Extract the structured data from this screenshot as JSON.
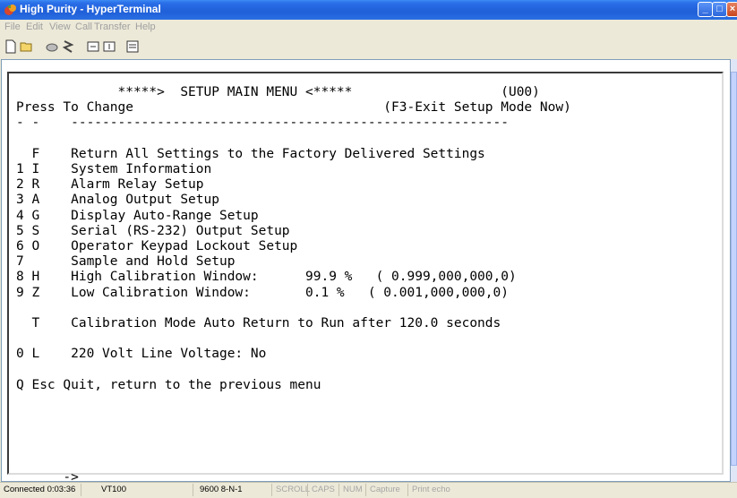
{
  "window": {
    "title": "High Purity - HyperTerminal"
  },
  "menu": [
    "File",
    "Edit",
    "View",
    "Call",
    "Transfer",
    "Help"
  ],
  "toolbar": {
    "icons": [
      "new-icon",
      "open-icon",
      "disconnect-icon",
      "properties-dial-icon",
      "send-icon",
      "receive-icon",
      "properties-icon"
    ]
  },
  "terminal": {
    "lines": [
      "             *****>  SETUP MAIN MENU <*****                   (U00)",
      "Press To Change                                (F3-Exit Setup Mode Now)",
      "- -    --------------------------------------------------------",
      "",
      "  F    Return All Settings to the Factory Delivered Settings",
      "1 I    System Information",
      "2 R    Alarm Relay Setup",
      "3 A    Analog Output Setup",
      "4 G    Display Auto-Range Setup",
      "5 S    Serial (RS-232) Output Setup",
      "6 O    Operator Keypad Lockout Setup",
      "7      Sample and Hold Setup",
      "8 H    High Calibration Window:      99.9 %   ( 0.999,000,000,0)",
      "9 Z    Low Calibration Window:       0.1 %   ( 0.001,000,000,0)",
      "",
      "  T    Calibration Mode Auto Return to Run after 120.0 seconds",
      "",
      "0 L    220 Volt Line Voltage: No",
      "",
      "Q Esc Quit, return to the previous menu",
      "",
      "",
      "",
      "",
      "",
      "      ->"
    ]
  },
  "status": {
    "connected": "Connected 0:03:36",
    "emulation": "VT100",
    "settings": "9600 8-N-1",
    "scroll": "SCROLL",
    "caps": "CAPS",
    "num": "NUM",
    "capture": "Capture",
    "print_echo": "Print echo"
  }
}
